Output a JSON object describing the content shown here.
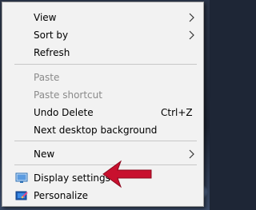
{
  "menu": {
    "items": {
      "view": {
        "label": "View",
        "icon": "chevron-right-icon"
      },
      "sort_by": {
        "label": "Sort by",
        "icon": "chevron-right-icon"
      },
      "refresh": {
        "label": "Refresh"
      },
      "paste": {
        "label": "Paste",
        "disabled": true
      },
      "paste_shortcut": {
        "label": "Paste shortcut",
        "disabled": true
      },
      "undo_delete": {
        "label": "Undo Delete",
        "shortcut": "Ctrl+Z"
      },
      "next_background": {
        "label": "Next desktop background"
      },
      "new": {
        "label": "New",
        "icon": "chevron-right-icon"
      },
      "display_settings": {
        "label": "Display settings",
        "icon": "monitor-icon"
      },
      "personalize": {
        "label": "Personalize",
        "icon": "personalize-icon"
      }
    }
  },
  "annotation": {
    "icon": "red-arrow-icon",
    "color": "#c8102e"
  },
  "colors": {
    "menu_bg": "#f2f2f2",
    "separator": "#c8c8c8",
    "disabled_text": "#8a8a8a"
  }
}
